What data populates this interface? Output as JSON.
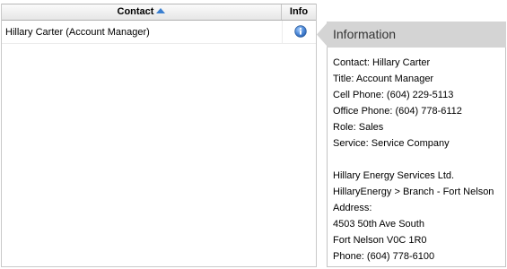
{
  "grid": {
    "columns": {
      "contact": "Contact",
      "info": "Info"
    },
    "sort": "ascending",
    "rows": [
      {
        "contact": "Hillary Carter (Account Manager)",
        "info_icon": "info-icon"
      }
    ]
  },
  "popover": {
    "title": "Information",
    "lines": [
      "Contact: Hillary Carter",
      "Title: Account Manager",
      "Cell Phone: (604) 229-5113",
      "Office Phone: (604) 778-6112",
      "Role: Sales",
      "Service: Service Company",
      "",
      "Hillary Energy Services Ltd.",
      "HillaryEnergy > Branch - Fort Nelson",
      "Address:",
      "4503 50th Ave South",
      "Fort Nelson V0C 1R0",
      "Phone: (604) 778-6100"
    ]
  },
  "colors": {
    "sort_arrow": "#3a7fd0",
    "info_icon": "#4a86d6",
    "popover_header": "#d4d4d4"
  }
}
